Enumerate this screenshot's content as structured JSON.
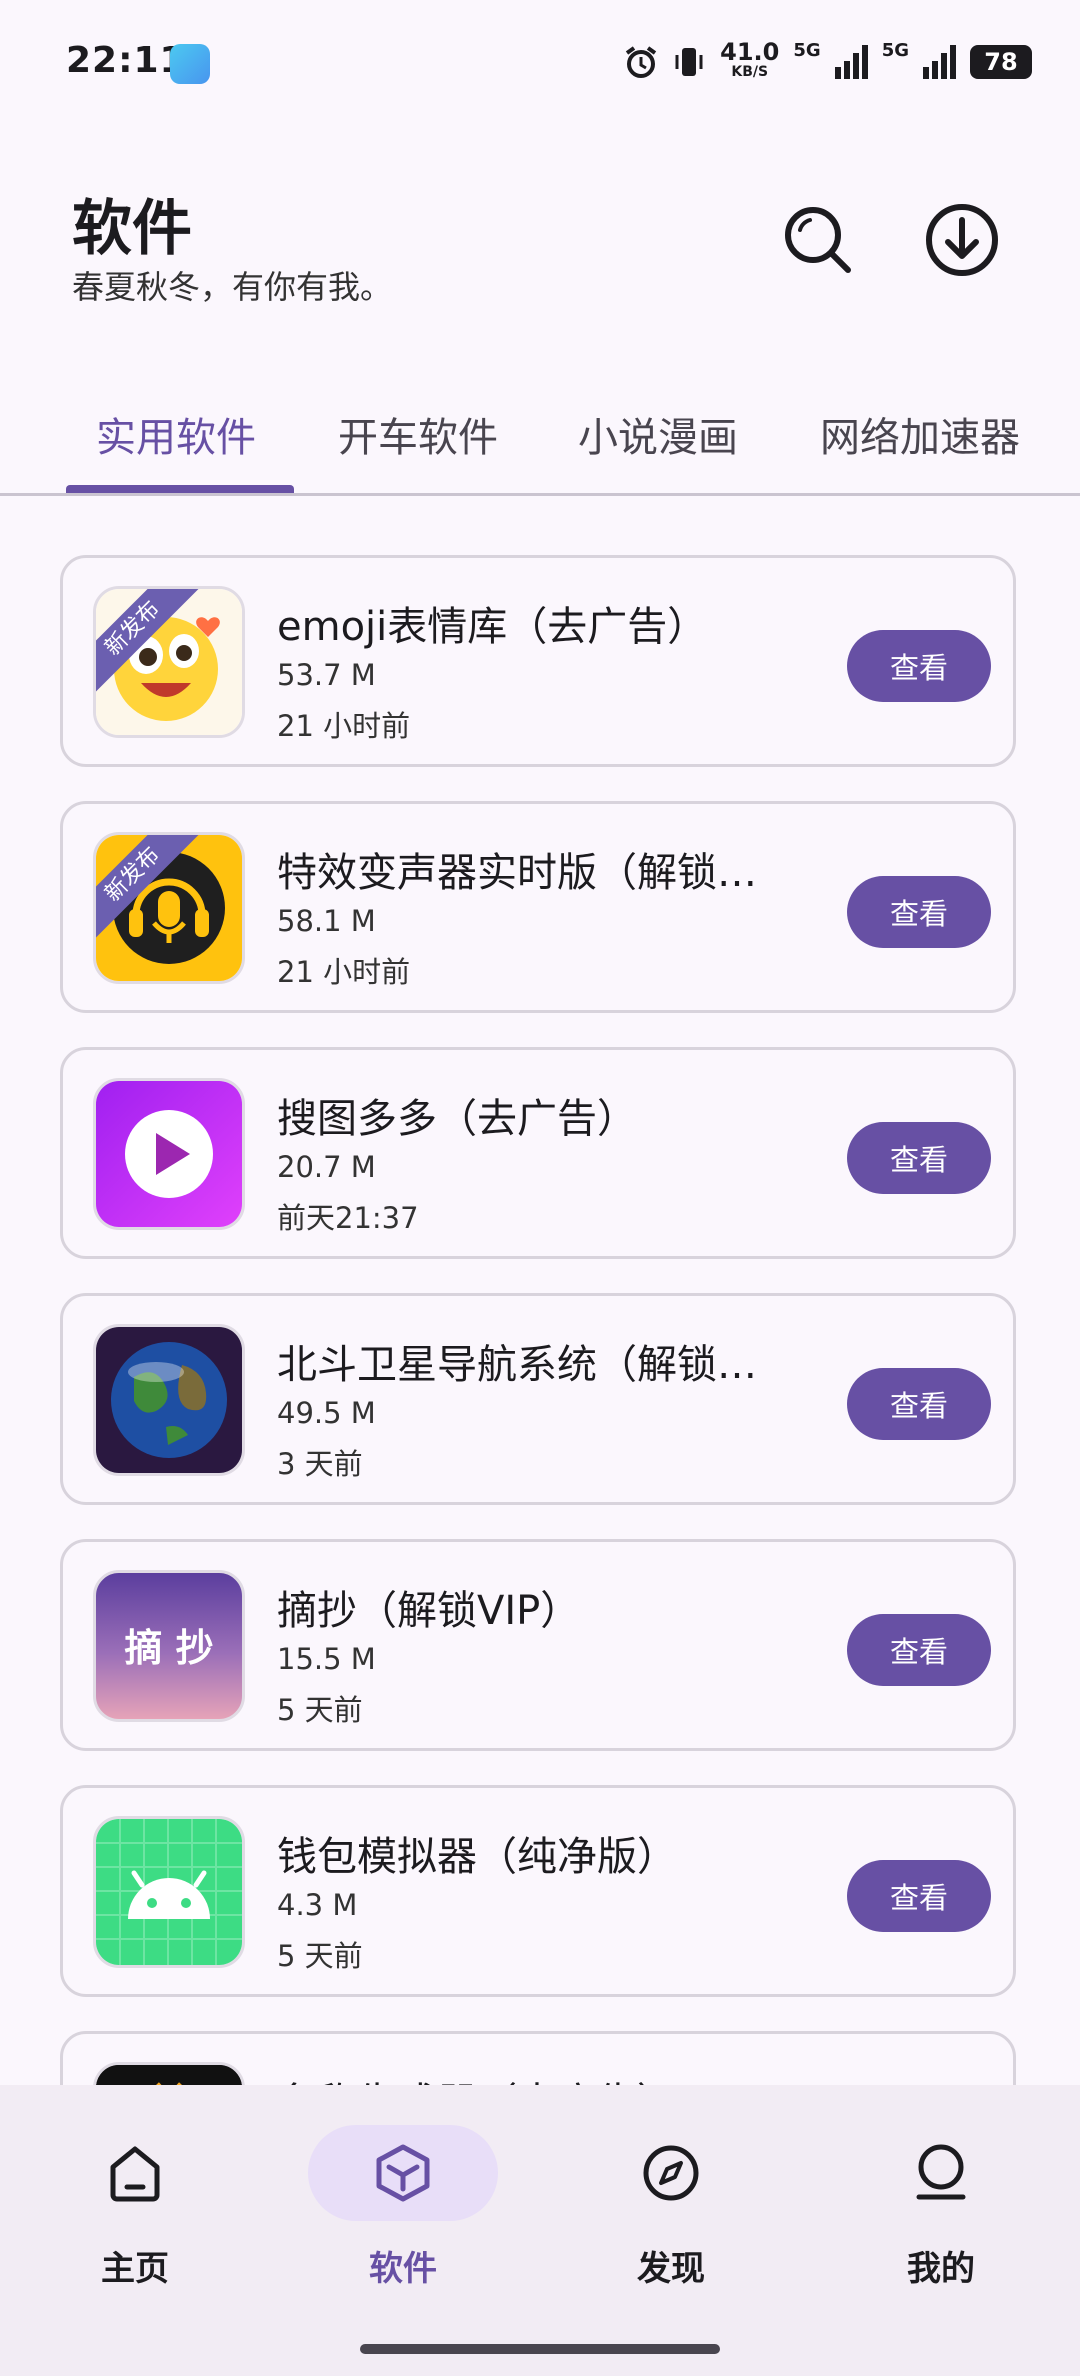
{
  "status_bar": {
    "time": "22:11",
    "speed_value": "41.0",
    "speed_unit": "KB/S",
    "net1": "5G",
    "net2": "5G",
    "battery": "78"
  },
  "header": {
    "title": "软件",
    "subtitle": "春夏秋冬，有你有我。",
    "search_icon": "search-icon",
    "download_icon": "download-icon"
  },
  "tabs": [
    {
      "label": "实用软件",
      "active": true
    },
    {
      "label": "开车软件",
      "active": false
    },
    {
      "label": "小说漫画",
      "active": false
    },
    {
      "label": "网络加速器",
      "active": false
    }
  ],
  "apps": [
    {
      "name": "emoji表情库（去广告）",
      "size": "53.7 M",
      "date": "21 小时前",
      "badge": "新发布",
      "button": "查看",
      "icon": "emoji-face-icon"
    },
    {
      "name": "特效变声器实时版（解锁…",
      "size": "58.1 M",
      "date": "21 小时前",
      "badge": "新发布",
      "button": "查看",
      "icon": "microphone-headphones-icon"
    },
    {
      "name": "搜图多多（去广告）",
      "size": "20.7 M",
      "date": "前天21:37",
      "badge": "",
      "button": "查看",
      "icon": "play-icon"
    },
    {
      "name": "北斗卫星导航系统（解锁…",
      "size": "49.5 M",
      "date": "3 天前",
      "badge": "",
      "button": "查看",
      "icon": "earth-icon"
    },
    {
      "name": "摘抄（解锁VIP）",
      "size": "15.5 M",
      "date": "5 天前",
      "badge": "",
      "button": "查看",
      "icon": "zhaichao-icon",
      "icon_text": "摘 抄"
    },
    {
      "name": "钱包模拟器（纯净版）",
      "size": "4.3 M",
      "date": "5 天前",
      "badge": "",
      "button": "查看",
      "icon": "android-icon"
    },
    {
      "name": "名称生成器（去广告）",
      "size": "",
      "date": "",
      "badge": "",
      "button": "",
      "icon": "app-icon"
    }
  ],
  "bottom_nav": [
    {
      "label": "主页",
      "icon": "home-icon",
      "active": false
    },
    {
      "label": "软件",
      "icon": "cube-icon",
      "active": true
    },
    {
      "label": "发现",
      "icon": "compass-icon",
      "active": false
    },
    {
      "label": "我的",
      "icon": "profile-icon",
      "active": false
    }
  ],
  "colors": {
    "accent": "#6750a4",
    "background": "#fbf7fd",
    "nav_background": "#f2ecf4",
    "active_pill": "#e8def8"
  }
}
